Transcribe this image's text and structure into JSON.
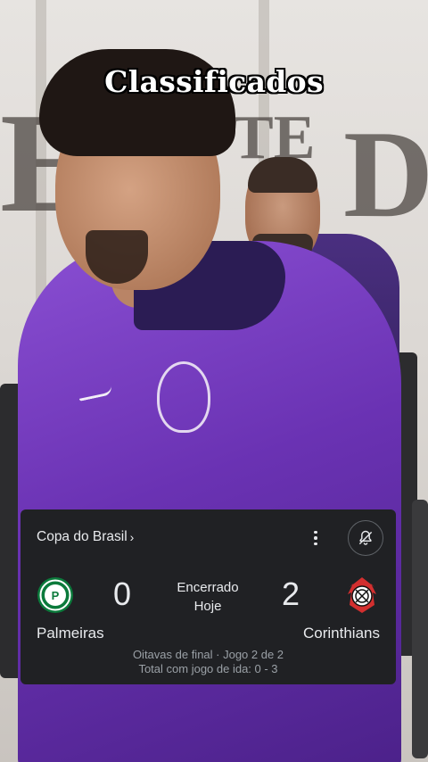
{
  "overlay": {
    "headline": "Classificados"
  },
  "match_card": {
    "competition": "Copa do Brasil",
    "competition_chevron": "›",
    "more_options_icon": "more-vert-icon",
    "notification_icon": "bell-off-icon",
    "home_team": {
      "name": "Palmeiras",
      "score": "0",
      "crest_icon": "palmeiras-crest-icon",
      "crest_color": "#0b7a3b"
    },
    "away_team": {
      "name": "Corinthians",
      "score": "2",
      "crest_icon": "corinthians-crest-icon",
      "crest_color": "#d32f2f"
    },
    "status": "Encerrado",
    "date": "Hoje",
    "round_info": "Oitavas de final · Jogo 2 de 2",
    "aggregate_info": "Total com jogo de ida: 0 - 3"
  },
  "colors": {
    "card_background": "#202124",
    "text_primary": "#e8eaed",
    "text_secondary": "#9aa0a6",
    "jersey_purple": "#6a32b3"
  }
}
